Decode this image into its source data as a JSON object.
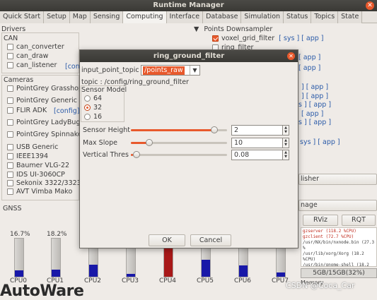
{
  "window": {
    "title": "Runtime Manager",
    "close_glyph": "✕"
  },
  "tabs": [
    "Quick Start",
    "Setup",
    "Map",
    "Sensing",
    "Computing",
    "Interface",
    "Database",
    "Simulation",
    "Status",
    "Topics",
    "State"
  ],
  "left": {
    "drivers_title": "Drivers",
    "can_title": "CAN",
    "can_items": [
      "can_converter",
      "can_draw",
      "can_listener"
    ],
    "config_link": "[config]",
    "cameras_title": "Cameras",
    "camera_items": [
      "PointGrey Grasshop",
      "PointGrey Generic",
      "FLIR ADK",
      "PointGrey LadyBug",
      "PointGrey Spinnake",
      "USB Generic",
      "IEEE1394",
      "Baumer VLG-22",
      "IDS UI-3060CP",
      "Sekonix 3322/3323",
      "AVT Vimba Mako"
    ],
    "gnss_title": "GNSS"
  },
  "right": {
    "section_title": "Points Downsampler",
    "items": [
      {
        "label": "voxel_grid_filter",
        "checked": true,
        "links": "[ sys ] [ app ]"
      },
      {
        "label": "ring_filter",
        "checked": false,
        "links": "[ sys ] [ app ]"
      }
    ],
    "partial_links": [
      "[ app ]",
      "[ app ]",
      "] [ app ]",
      "] [ app ]",
      "s ] [ app ]",
      "[ app ]",
      "s ] [ app ]",
      "sys ] [ app ]"
    ],
    "publisher_btn": "lisher",
    "image_btn": "nage",
    "rviz_btn": "RViz",
    "rqt_btn": "RQT"
  },
  "cpu": [
    {
      "label": "CPU0",
      "pct": "16.7%",
      "value": 16.7
    },
    {
      "label": "CPU1",
      "pct": "18.2%",
      "value": 18.2
    },
    {
      "label": "CPU2",
      "pct": "",
      "value": 32
    },
    {
      "label": "CPU3",
      "pct": "",
      "value": 5
    },
    {
      "label": "CPU4",
      "pct": "",
      "value": 100
    },
    {
      "label": "CPU5",
      "pct": "",
      "value": 45
    },
    {
      "label": "CPU6",
      "pct": "",
      "value": 30
    },
    {
      "label": "CPU7",
      "pct": "",
      "value": 12
    }
  ],
  "colors": {
    "cpu_normal": "#1818a8",
    "cpu_high": "#a81818",
    "accent": "#e8592c"
  },
  "processes": [
    {
      "text": "gzserver (118.2 %CPU)",
      "red": true
    },
    {
      "text": "gzclient (72.7 %CPU)",
      "red": true
    },
    {
      "text": "/usr/NX/bin/nxnode.bin (27.3 %",
      "red": false
    },
    {
      "text": "/usr/lib/xorg/Xorg (18.2 %CPU)",
      "red": false
    },
    {
      "text": "/usr/bin/gnome-shell (18.2 %CPU",
      "red": false
    }
  ],
  "memory": {
    "label": "Memory",
    "value": "5GB/15GB(32%)"
  },
  "logo": "AutoWare",
  "watermark": "CSDN @Coca_Car",
  "dialog": {
    "title": "ring_ground_filter",
    "input_label": "input_point_topic",
    "input_value": "/points_raw",
    "topic_label": "topic : /config/ring_ground_filter",
    "sensor_model_title": "Sensor Model",
    "sensor_options": [
      "64",
      "32",
      "16"
    ],
    "sensor_selected": "32",
    "params": [
      {
        "label": "Sensor Height",
        "value": "2",
        "fraction": 0.9
      },
      {
        "label": "Max Slope",
        "value": "10",
        "fraction": 0.17
      },
      {
        "label": "Vertical Thres",
        "value": "0.08",
        "fraction": 0.02
      }
    ],
    "ok": "OK",
    "cancel": "Cancel"
  }
}
